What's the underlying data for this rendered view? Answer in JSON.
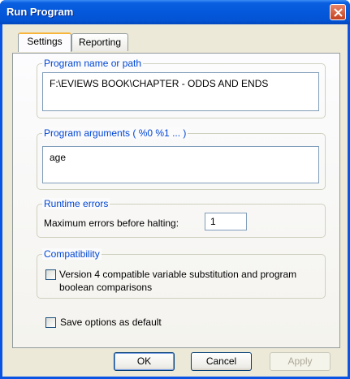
{
  "window": {
    "title": "Run Program"
  },
  "tabs": [
    {
      "label": "Settings",
      "active": true
    },
    {
      "label": "Reporting",
      "active": false
    }
  ],
  "program_name": {
    "label": "Program name or path",
    "value": "F:\\EVIEWS BOOK\\CHAPTER - ODDS AND ENDS"
  },
  "program_args": {
    "label": "Program arguments ( %0  %1 ... )",
    "value": "age"
  },
  "runtime_errors": {
    "label": "Runtime errors",
    "max_errors_label": "Maximum errors before halting:",
    "max_errors_value": "1"
  },
  "compatibility": {
    "label": "Compatibility",
    "checkbox_line1": "Version 4 compatible variable substitution and program",
    "checkbox_line2": "boolean comparisons",
    "checked": false
  },
  "save_default": {
    "label": "Save options as default",
    "checked": false
  },
  "buttons": {
    "ok": "OK",
    "cancel": "Cancel",
    "apply": "Apply"
  },
  "colors": {
    "title_bar": "#0458db",
    "group_label": "#0046d5",
    "dialog_bg": "#ece9d8",
    "tab_highlight": "#f8b53c"
  }
}
